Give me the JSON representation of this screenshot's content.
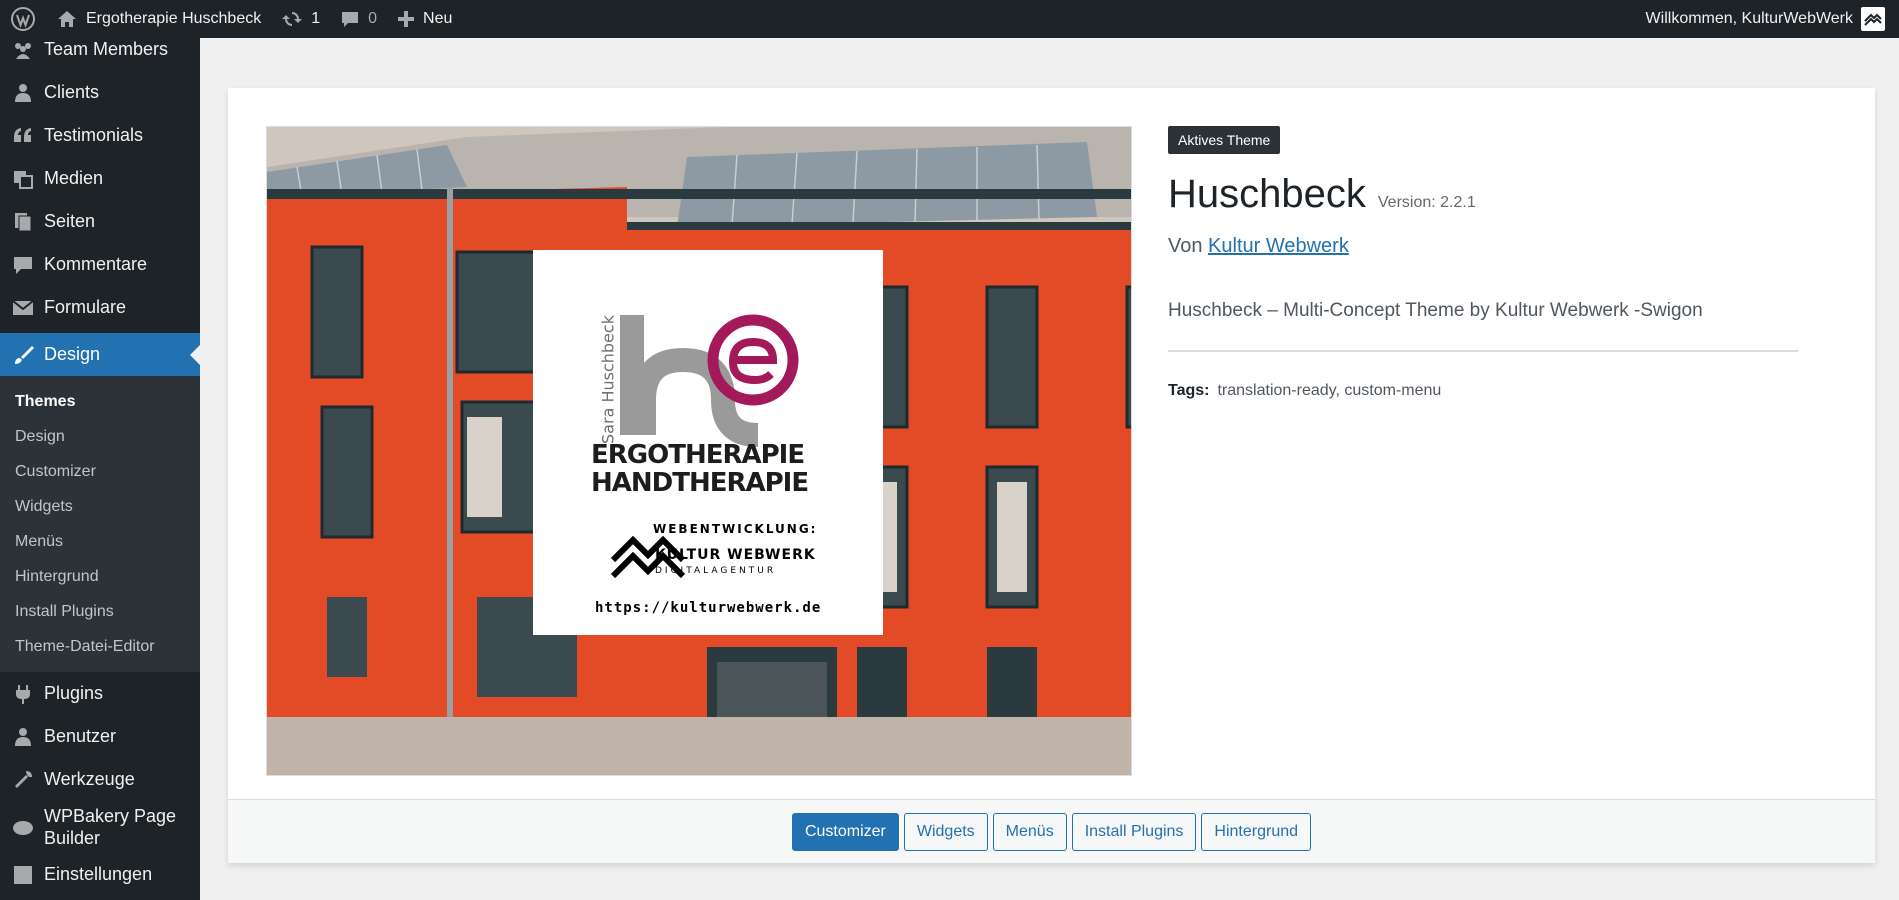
{
  "adminbar": {
    "site_name": "Ergotherapie Huschbeck",
    "updates_count": "1",
    "comments_count": "0",
    "new_label": "Neu",
    "welcome": "Willkommen, KulturWebWerk"
  },
  "sidebar": {
    "items_top": [
      {
        "label": "Team Members",
        "icon": "groups-icon"
      },
      {
        "label": "Clients",
        "icon": "businessperson-icon"
      },
      {
        "label": "Testimonials",
        "icon": "quote-icon"
      },
      {
        "label": "Medien",
        "icon": "media-icon"
      },
      {
        "label": "Seiten",
        "icon": "pages-icon"
      },
      {
        "label": "Kommentare",
        "icon": "comments-icon"
      },
      {
        "label": "Formulare",
        "icon": "email-icon"
      }
    ],
    "active": {
      "label": "Design",
      "icon": "brush-icon"
    },
    "submenu": [
      "Themes",
      "Design",
      "Customizer",
      "Widgets",
      "Menüs",
      "Hintergrund",
      "Install Plugins",
      "Theme-Datei-Editor"
    ],
    "items_bottom": [
      {
        "label": "Plugins",
        "icon": "plugin-icon"
      },
      {
        "label": "Benutzer",
        "icon": "users-icon"
      },
      {
        "label": "Werkzeuge",
        "icon": "tools-icon"
      },
      {
        "label": "WPBakery Page Builder",
        "icon": "cloud-icon"
      },
      {
        "label": "Einstellungen",
        "icon": "settings-icon"
      }
    ]
  },
  "theme": {
    "badge": "Aktives Theme",
    "name": "Huschbeck",
    "version": "Version: 2.2.1",
    "author_prefix": "Von",
    "author": "Kultur Webwerk",
    "description": "Huschbeck – Multi-Concept Theme by Kultur Webwerk -Swigon",
    "tags_label": "Tags:",
    "tags": "translation-ready, custom-menu"
  },
  "screenshot": {
    "vertical_name": "Sara Huschbeck",
    "line1": "ERGOTHERAPIE",
    "line2": "HANDTHERAPIE",
    "dev_label": "WEBENTWICKLUNG:",
    "agency": "KULTUR WEBWERK",
    "agency_sub": "DIGITALAGENTUR",
    "url": "https://kulturwebwerk.de"
  },
  "actions": [
    "Customizer",
    "Widgets",
    "Menüs",
    "Install Plugins",
    "Hintergrund"
  ],
  "colors": {
    "accent": "#2271b1",
    "admin_dark": "#1d2327",
    "logo_magenta": "#a3195b",
    "logo_gray": "#9a9a9a",
    "facade_orange": "#e34a26"
  }
}
